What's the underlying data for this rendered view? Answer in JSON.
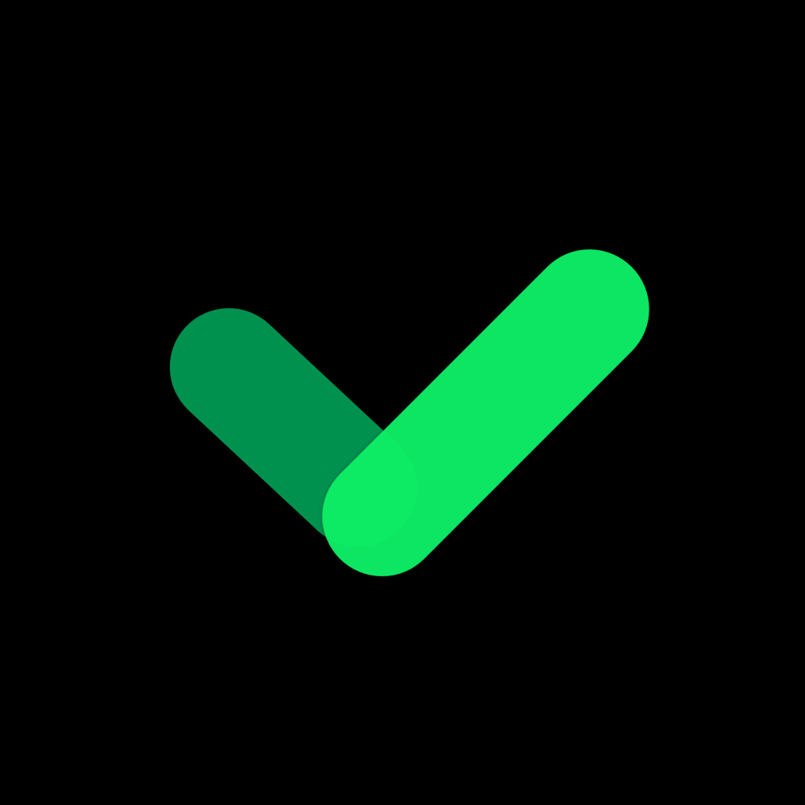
{
  "icon": {
    "name": "checkmark-icon",
    "background_color": "#000000",
    "short_stroke_color": "#02914F",
    "long_stroke_color": "#08EE65",
    "long_stroke_opacity": 0.96
  }
}
